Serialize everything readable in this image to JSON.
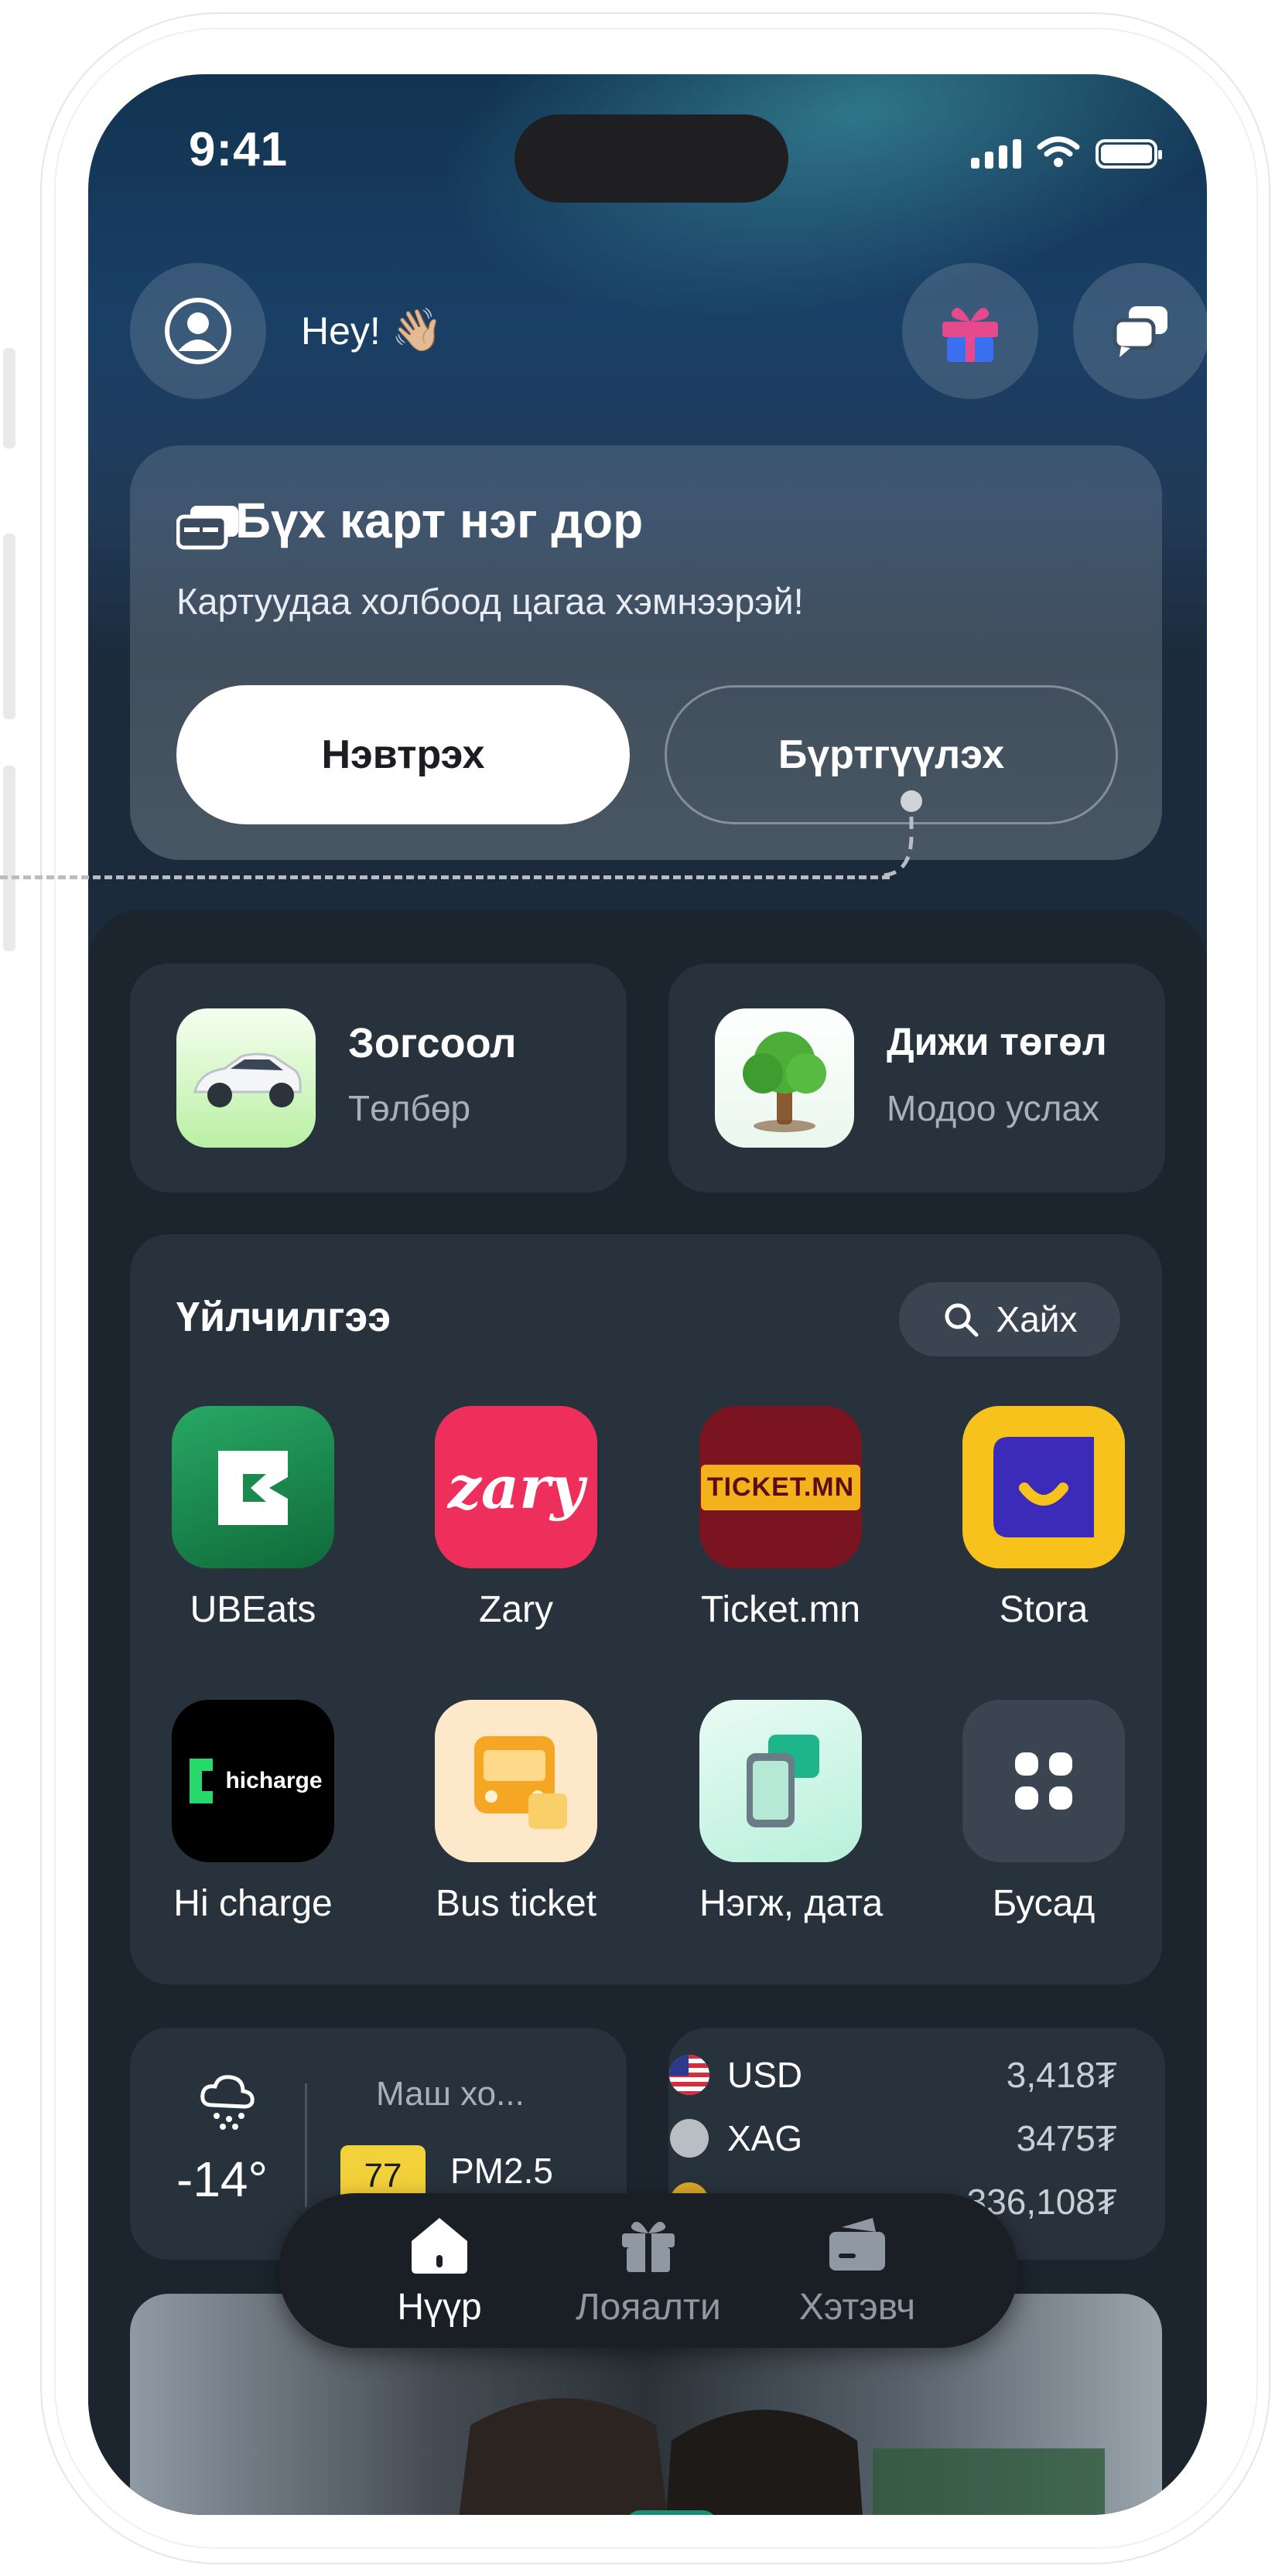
{
  "status_bar": {
    "time": "9:41"
  },
  "header": {
    "greeting": "Hey!",
    "wave": "👋🏼"
  },
  "cards_promo": {
    "title": "Бүх карт нэг дор",
    "subtitle": "Картуудаа холбоод цагаа хэмнээрэй!",
    "login_label": "Нэвтрэх",
    "register_label": "Бүртгүүлэх"
  },
  "quick_actions": [
    {
      "title": "Зогсоол",
      "subtitle": "Төлбөр",
      "icon": "car-icon"
    },
    {
      "title": "Дижи төгөл",
      "subtitle": "Модоо услах",
      "icon": "tree-icon"
    }
  ],
  "services": {
    "title": "Үйлчилгээ",
    "search_label": "Хайх",
    "apps": [
      {
        "label": "UBEats",
        "icon": "ubeats-icon",
        "color": "#1b8a4e"
      },
      {
        "label": "Zary",
        "icon": "zary-icon",
        "logo_text": "zary",
        "color": "#ef2f5b"
      },
      {
        "label": "Ticket.mn",
        "icon": "ticket-icon",
        "logo_text": "TICKET.MN",
        "color": "#7a1420"
      },
      {
        "label": "Stora",
        "icon": "stora-icon",
        "color": "#f6c21b"
      },
      {
        "label": "Hi charge",
        "icon": "hicharge-icon",
        "logo_text": "hicharge",
        "color": "#000000"
      },
      {
        "label": "Bus ticket",
        "icon": "bus-icon",
        "color": "#fde8c9"
      },
      {
        "label": "Нэгж, дата",
        "icon": "sim-icon",
        "color": "#ccf5e6"
      },
      {
        "label": "Бусад",
        "icon": "grid-icon",
        "color": "#3a4551"
      }
    ]
  },
  "weather": {
    "temperature": "-14°",
    "status": "Маш хо...",
    "aqi": "77",
    "aqi_label": "PM2.5"
  },
  "currency": [
    {
      "code": "USD",
      "value": "3,418₮"
    },
    {
      "code": "XAG",
      "value": "3475₮"
    },
    {
      "code": "",
      "value": "336,108₮"
    }
  ],
  "tabbar": [
    {
      "label": "Нүүр",
      "icon": "home-icon",
      "active": true
    },
    {
      "label": "Лояалти",
      "icon": "gift-icon",
      "active": false
    },
    {
      "label": "Хэтэвч",
      "icon": "wallet-icon",
      "active": false
    }
  ]
}
